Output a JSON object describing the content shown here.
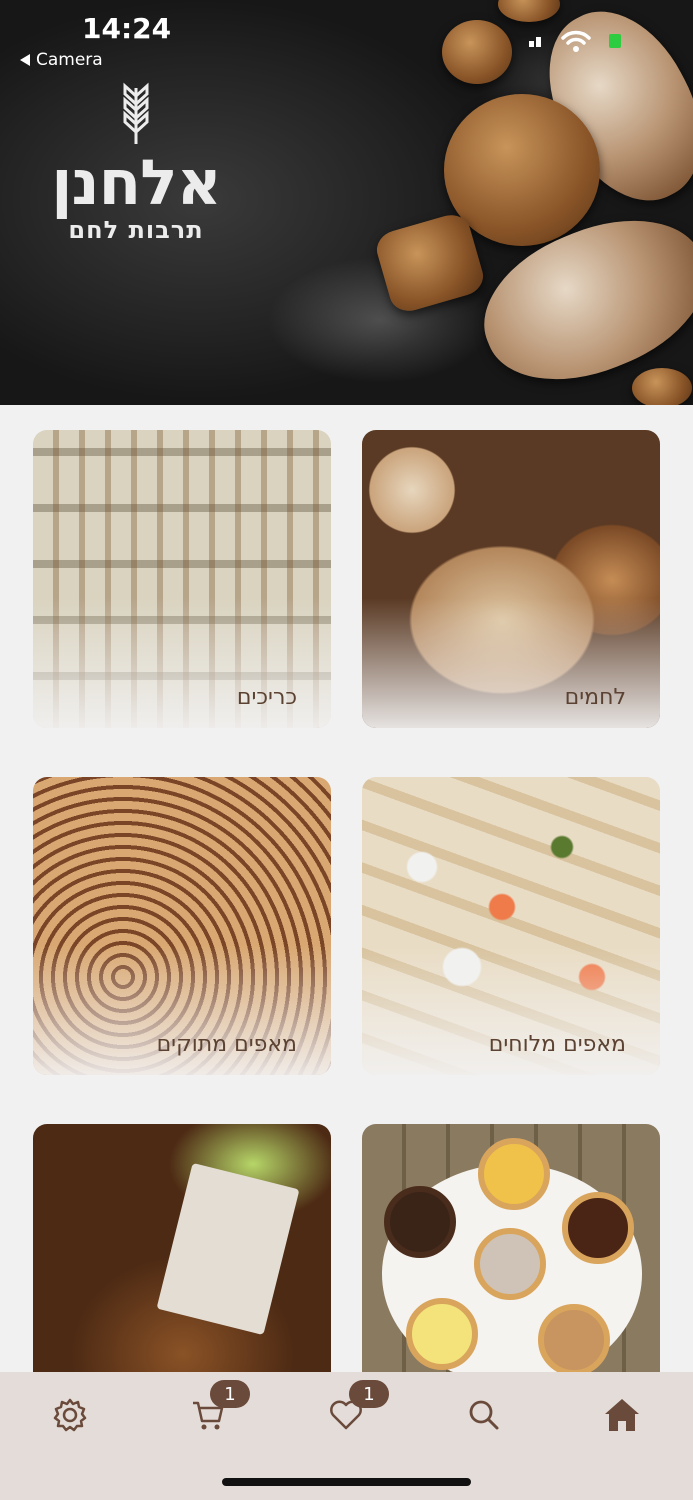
{
  "status_bar": {
    "time": "14:24",
    "back_label": "Camera"
  },
  "brand": {
    "name": "אלחנן",
    "tagline": "תרבות לחם"
  },
  "categories": [
    {
      "label": "כריכים",
      "image": "sandwiches"
    },
    {
      "label": "לחמים",
      "image": "breads"
    },
    {
      "label": "מאפים מתוקים",
      "image": "sweet-pastries"
    },
    {
      "label": "מאפים מלוחים",
      "image": "salty-pastries"
    },
    {
      "label": "",
      "image": "gift-package"
    },
    {
      "label": "",
      "image": "tarts"
    }
  ],
  "tabbar": {
    "cart_count": "1",
    "favorites_count": "1",
    "icons": [
      "gear-icon",
      "cart-icon",
      "heart-icon",
      "search-icon",
      "home-icon"
    ]
  },
  "colors": {
    "accent": "#6a4a3b",
    "label_text": "#5b4232",
    "tabbar_bg": "#e4dcd8",
    "page_bg": "#f2f1f1"
  }
}
